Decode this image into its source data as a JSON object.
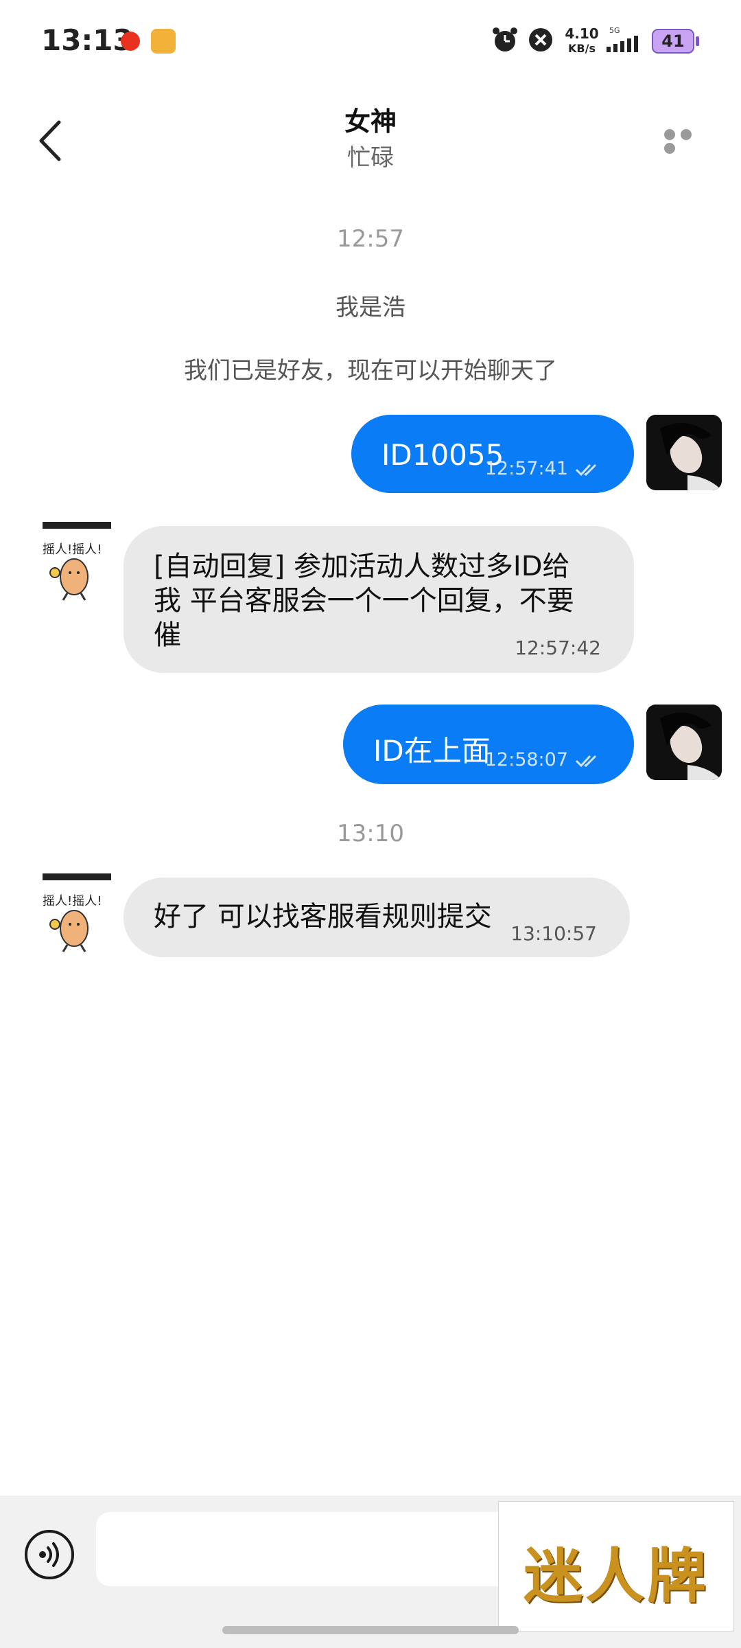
{
  "status_bar": {
    "time": "13:13",
    "net_speed_value": "4.10",
    "net_speed_unit": "KB/s",
    "network_type": "5G",
    "battery": "41"
  },
  "header": {
    "title": "女神",
    "subtitle": "忙碌"
  },
  "chat": {
    "time_separator_1": "12:57",
    "system_messages": [
      "我是浩",
      "我们已是好友，现在可以开始聊天了"
    ],
    "messages": [
      {
        "direction": "out",
        "text": "ID10055",
        "time": "12:57:41",
        "status": "read"
      },
      {
        "direction": "in",
        "lines": [
          "[自动回复] 参加活动人数过多ID给",
          "我  平台客服会一个一个回复，不要",
          "催"
        ],
        "time": "12:57:42"
      },
      {
        "direction": "out",
        "text": "ID在上面",
        "time": "12:58:07",
        "status": "read"
      }
    ],
    "time_separator_2": "13:10",
    "last_message": {
      "direction": "in",
      "text": "好了  可以找客服看规则提交",
      "time": "13:10:57"
    }
  },
  "input": {
    "placeholder": "",
    "value": ""
  },
  "watermark": {
    "text": "迷人牌"
  },
  "colors": {
    "outgoing_bubble": "#0a7cf5",
    "incoming_bubble": "#e9e9e9",
    "watermark": "#c9921f"
  },
  "icons": [
    "back-arrow-icon",
    "more-dots-icon",
    "alarm-icon",
    "mute-icon",
    "signal-icon",
    "battery-icon",
    "voice-icon",
    "double-check-icon"
  ]
}
